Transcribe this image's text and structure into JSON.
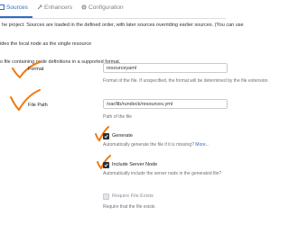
{
  "tabs": [
    {
      "label": "Sources",
      "icon": "sources-icon",
      "active": true
    },
    {
      "label": "Enhancers",
      "icon": "enhancers-icon",
      "active": false
    },
    {
      "label": "Configuration",
      "icon": "configuration-icon",
      "active": false
    }
  ],
  "info": {
    "line1": "he project. Sources are loaded in the defined order, with later sources overriding earlier sources. (You can use",
    "line2": "ides the local node as the single resource",
    "line3": "o file containing node definitions in a supported format."
  },
  "fields": {
    "format": {
      "label": "Format",
      "value": "resourceyaml",
      "help": "Format of the file. If unspecified, the format will be determined by the file extension."
    },
    "file_path": {
      "label": "File Path",
      "value": "/var/lib/rundeck/resources.yml",
      "help": "Path of the file"
    },
    "generate": {
      "label": "Generate",
      "checked": true,
      "help": "Automatically generate the file if it is missing?",
      "more": "More..."
    },
    "include_server_node": {
      "label": "Include Server Node",
      "checked": true,
      "help": "Automatically include the server node in the generated file?"
    },
    "require_file_exists": {
      "label": "Require File Exists",
      "checked": false,
      "help": "Require that the file exists"
    }
  },
  "colors": {
    "accent": "#2f6fc5",
    "annotation": "#f07a10"
  }
}
